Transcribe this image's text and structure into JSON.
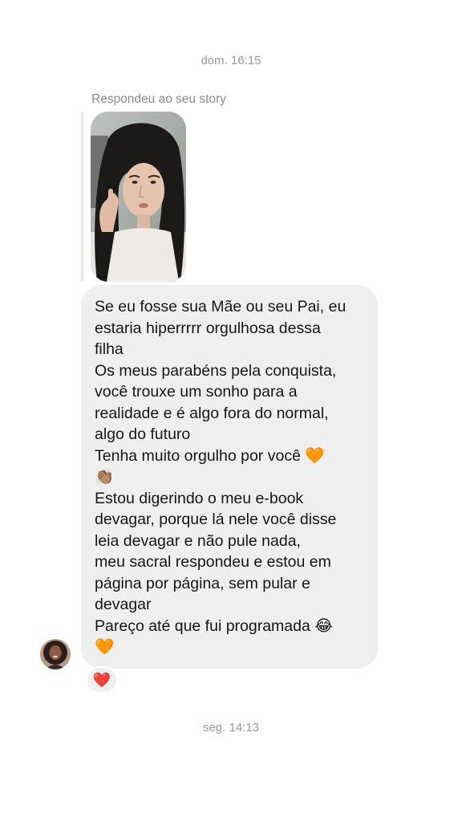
{
  "thread": {
    "top_timestamp": "dom. 16:15",
    "bottom_timestamp": "seg. 14:13"
  },
  "story_reply": {
    "label": "Respondeu ao seu story"
  },
  "message": {
    "lines": [
      "Se eu fosse sua Mãe ou seu Pai, eu",
      "estaria hiperrrrr orgulhosa dessa",
      "filha",
      "Os meus parabéns pela conquista,",
      "você trouxe um sonho para a",
      "realidade e é algo fora do normal,",
      "algo do futuro",
      "Tenha muito orgulho por você 🧡",
      "👏🏽",
      "Estou digerindo o meu e-book",
      "devagar, porque lá nele você disse",
      "leia devagar e não pule nada,",
      "meu sacral respondeu e estou em",
      "página por página, sem pular e",
      "devagar",
      "Pareço até que fui programada 😂",
      "🧡"
    ]
  },
  "reaction": {
    "emoji": "❤️"
  },
  "icons": {
    "avatar": "sender-avatar",
    "story": "story-thumbnail"
  }
}
